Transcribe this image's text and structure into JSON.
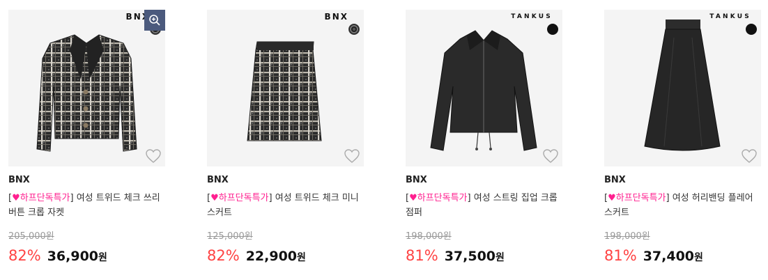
{
  "products": [
    {
      "brand_mark": "BNX",
      "brand": "BNX",
      "title": {
        "open": "[",
        "heart": "♥",
        "promo": "하프단독특가",
        "close": "]",
        "text": " 여성 트위드 체크 쓰리버튼 크롭 자켓"
      },
      "original_price": "205,000원",
      "discount_rate": "82%",
      "sale_price": "36,900",
      "currency": "원",
      "swatch": "tweed",
      "image": "tweed-jacket",
      "zoom_icon": "zoom-in-icon"
    },
    {
      "brand_mark": "BNX",
      "brand": "BNX",
      "title": {
        "open": "[",
        "heart": "♥",
        "promo": "하프단독특가",
        "close": "]",
        "text": " 여성 트위드 체크 미니 스커트"
      },
      "original_price": "125,000원",
      "discount_rate": "82%",
      "sale_price": "22,900",
      "currency": "원",
      "swatch": "tweed",
      "image": "tweed-mini-skirt"
    },
    {
      "brand_mark": "TANKUS",
      "brand": "BNX",
      "title": {
        "open": "[",
        "heart": "♥",
        "promo": "하프단독특가",
        "close": "]",
        "text": " 여성 스트링 집업 크롭 점퍼"
      },
      "original_price": "198,000원",
      "discount_rate": "81%",
      "sale_price": "37,500",
      "currency": "원",
      "swatch": "black",
      "image": "black-crop-jumper"
    },
    {
      "brand_mark": "TANKUS",
      "brand": "BNX",
      "title": {
        "open": "[",
        "heart": "♥",
        "promo": "하프단독특가",
        "close": "]",
        "text": " 여성 허리밴딩 플레어 스커트"
      },
      "original_price": "198,000원",
      "discount_rate": "81%",
      "sale_price": "37,400",
      "currency": "원",
      "swatch": "black",
      "image": "black-flare-skirt"
    }
  ],
  "colors": {
    "discount": "#ff4242",
    "promo": "#ff1f8f",
    "zoom_button": "#4b5a7d",
    "thumb_bg": "#f4f4f4"
  }
}
